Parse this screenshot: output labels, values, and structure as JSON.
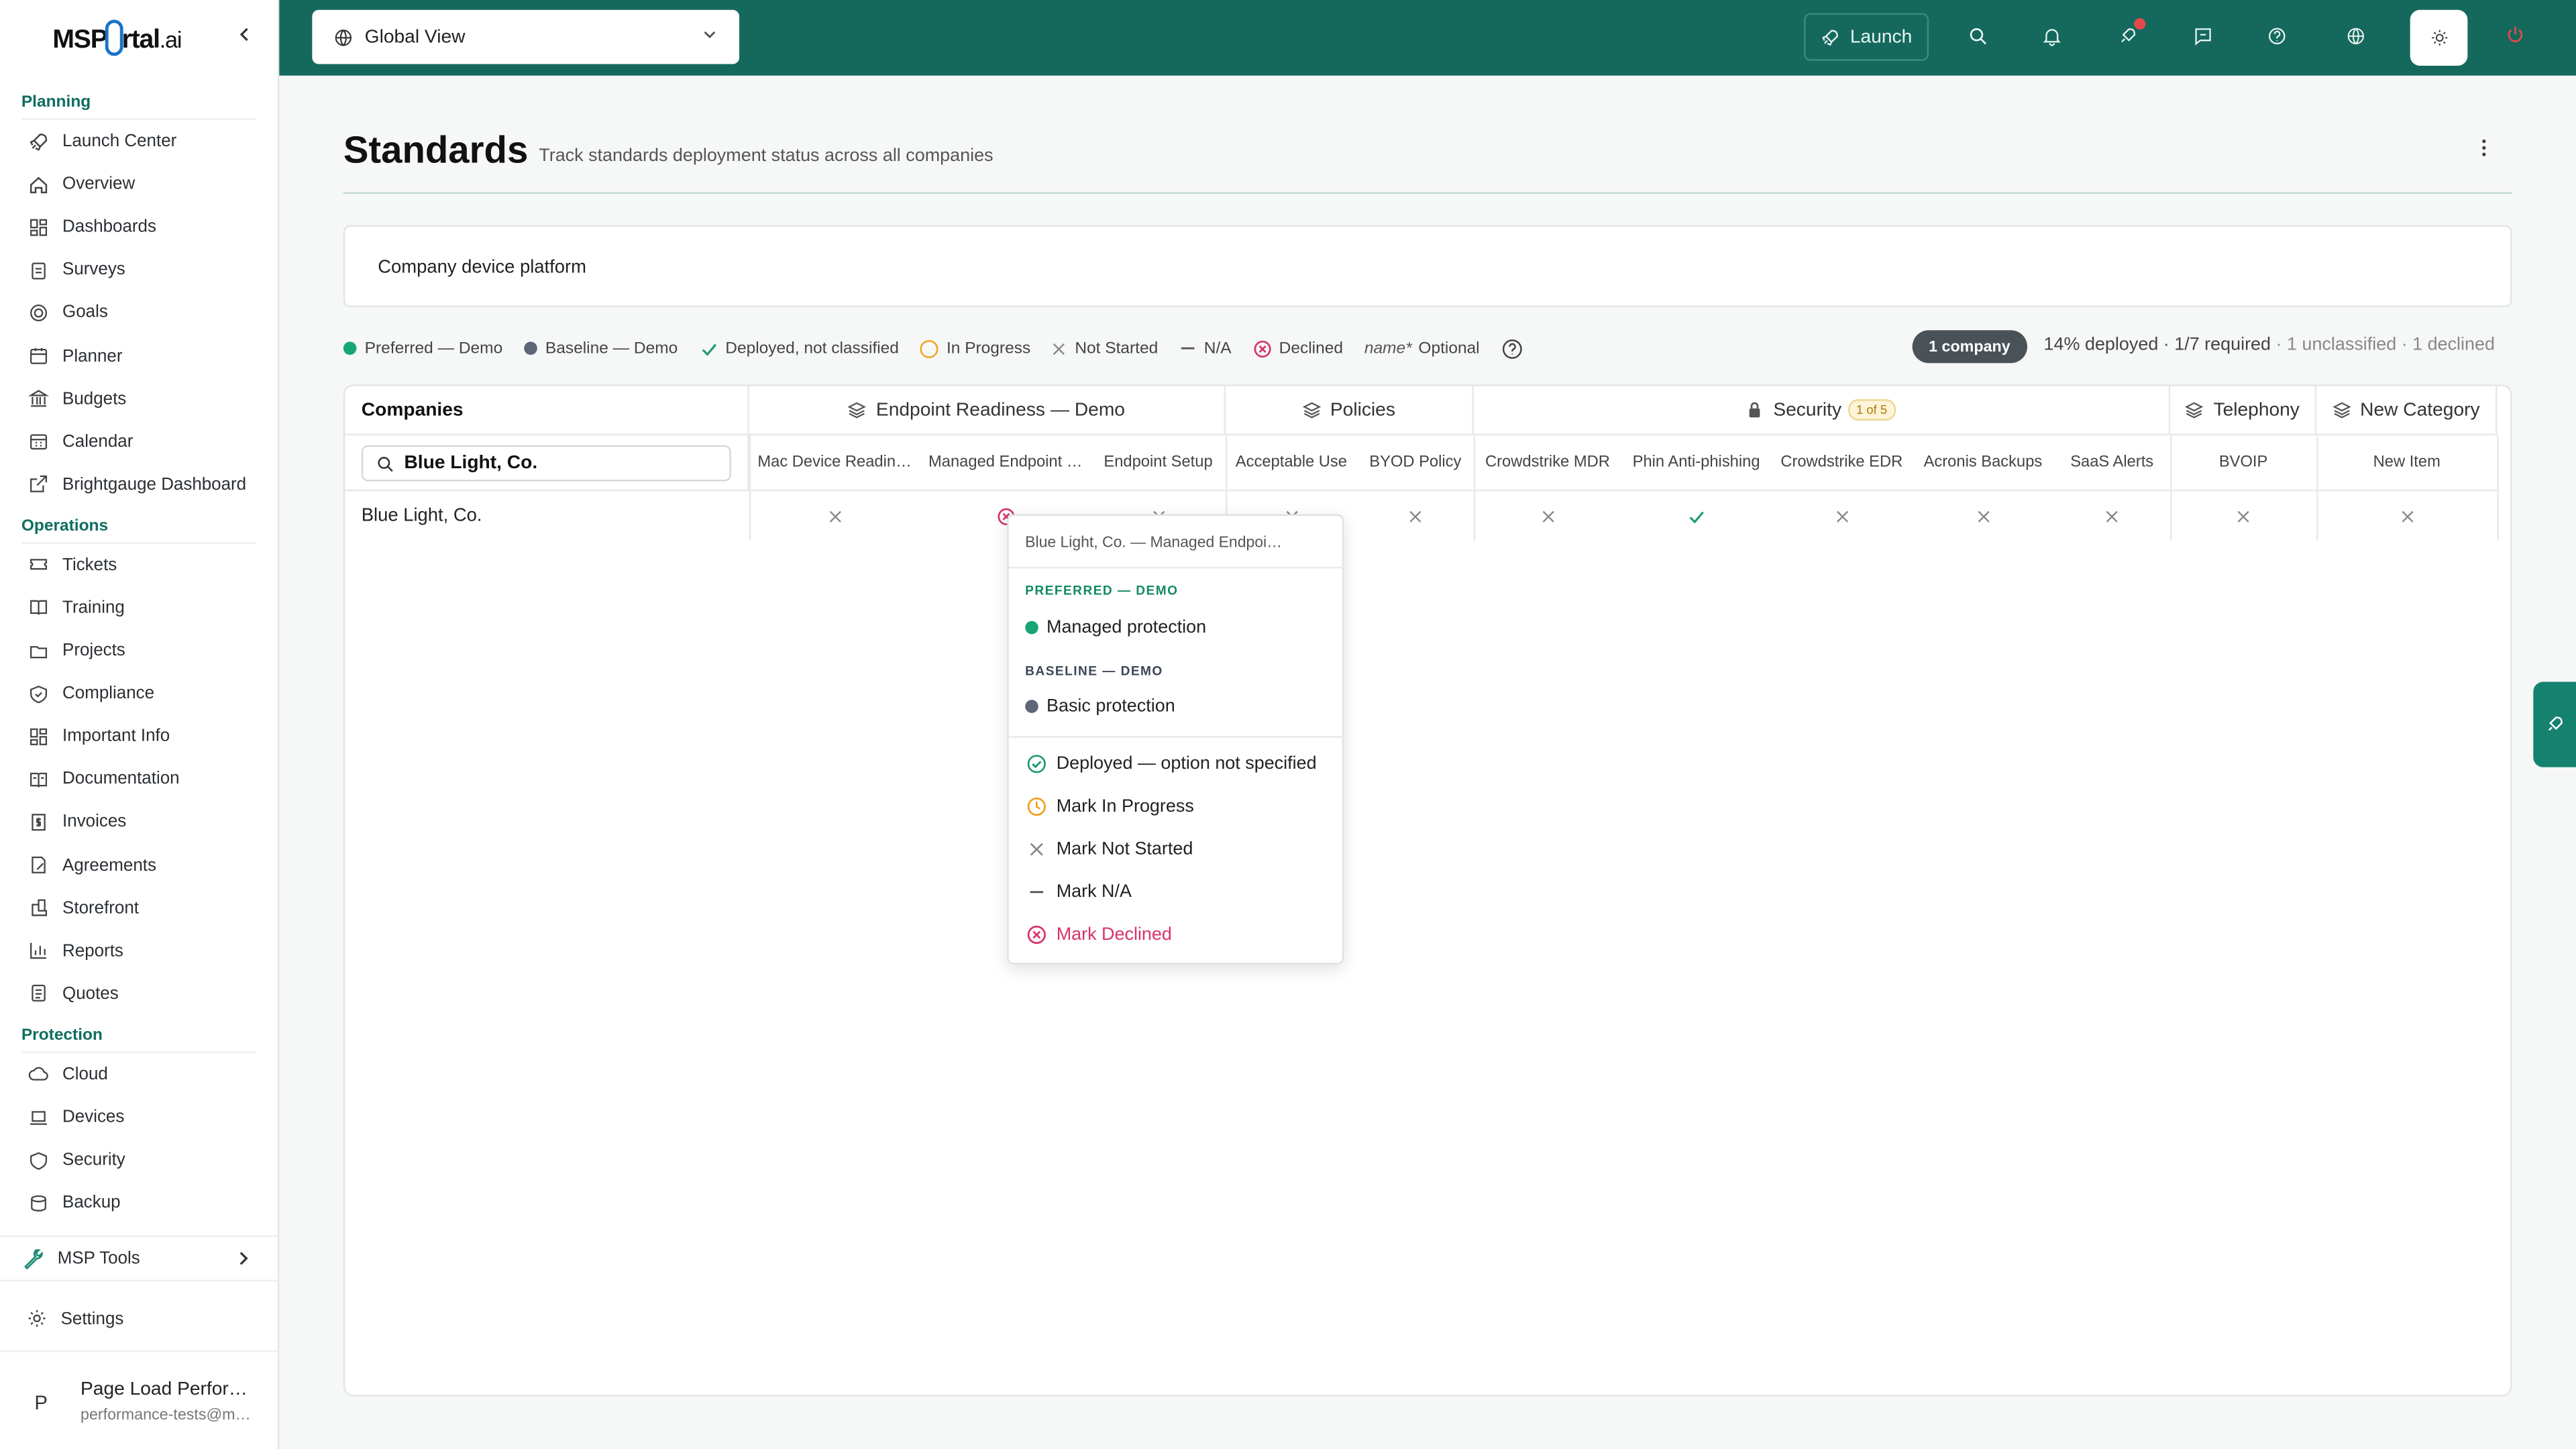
{
  "brand": {
    "logo_left": "MSP",
    "logo_right": "rtal",
    "logo_ai": ".ai"
  },
  "sidebar": {
    "sections": [
      {
        "title": "Planning",
        "items": [
          {
            "label": "Launch Center",
            "icon": "rocket-icon"
          },
          {
            "label": "Overview",
            "icon": "home-icon"
          },
          {
            "label": "Dashboards",
            "icon": "grid-icon"
          },
          {
            "label": "Surveys",
            "icon": "clipboard-icon"
          },
          {
            "label": "Goals",
            "icon": "target-icon"
          },
          {
            "label": "Planner",
            "icon": "calendar-icon"
          },
          {
            "label": "Budgets",
            "icon": "bank-icon"
          },
          {
            "label": "Calendar",
            "icon": "calendar-grid-icon"
          },
          {
            "label": "Brightgauge Dashboard",
            "icon": "external-link-icon"
          }
        ]
      },
      {
        "title": "Operations",
        "items": [
          {
            "label": "Tickets",
            "icon": "ticket-icon"
          },
          {
            "label": "Training",
            "icon": "book-icon"
          },
          {
            "label": "Projects",
            "icon": "folder-icon"
          },
          {
            "label": "Compliance",
            "icon": "shield-check-icon"
          },
          {
            "label": "Important Info",
            "icon": "grid-icon"
          },
          {
            "label": "Documentation",
            "icon": "book-open-icon"
          },
          {
            "label": "Invoices",
            "icon": "invoice-icon"
          },
          {
            "label": "Agreements",
            "icon": "file-sign-icon"
          },
          {
            "label": "Storefront",
            "icon": "store-icon"
          },
          {
            "label": "Reports",
            "icon": "bar-chart-icon"
          },
          {
            "label": "Quotes",
            "icon": "file-icon"
          }
        ]
      },
      {
        "title": "Protection",
        "items": [
          {
            "label": "Cloud",
            "icon": "cloud-icon"
          },
          {
            "label": "Devices",
            "icon": "laptop-icon"
          },
          {
            "label": "Security",
            "icon": "shield-icon"
          },
          {
            "label": "Backup",
            "icon": "database-icon"
          }
        ]
      }
    ],
    "tools_label": "MSP Tools",
    "settings_label": "Settings",
    "user": {
      "initial": "P",
      "name": "Page Load Perfor…",
      "email": "performance-tests@m…"
    }
  },
  "topbar": {
    "scope": "Global View",
    "launch_label": "Launch"
  },
  "page": {
    "title": "Standards",
    "subtitle": "Track standards deployment status across all companies",
    "platform_label": "Company device platform"
  },
  "legend": {
    "preferred": "Preferred — Demo",
    "baseline": "Baseline — Demo",
    "deployed": "Deployed, not classified",
    "in_progress": "In Progress",
    "not_started": "Not Started",
    "na": "N/A",
    "declined": "Declined",
    "optional_prefix": "name*",
    "optional": "Optional"
  },
  "summary": {
    "companies_badge": "1 company",
    "deployed": "14% deployed · 1/7 required",
    "extra": " · 1 unclassified · 1 declined"
  },
  "table": {
    "companies_header": "Companies",
    "search_value": "Blue Light, Co.",
    "groups": [
      {
        "label": "Endpoint Readiness — Demo",
        "icon": "layers-icon"
      },
      {
        "label": "Policies",
        "icon": "layers-icon"
      },
      {
        "label": "Security",
        "icon": "lock-icon",
        "badge": "1 of 5"
      },
      {
        "label": "Telephony",
        "icon": "layers-icon"
      },
      {
        "label": "New Category",
        "icon": "layers-icon"
      }
    ],
    "columns": [
      "Mac Device Readin…",
      "Managed Endpoint …",
      "Endpoint Setup",
      "Acceptable Use",
      "BYOD Policy",
      "Crowdstrike MDR",
      "Phin Anti-phishing",
      "Crowdstrike EDR",
      "Acronis Backups",
      "SaaS Alerts",
      "BVOIP",
      "New Item"
    ],
    "rows": [
      {
        "company": "Blue Light, Co.",
        "statuses": [
          "not-started",
          "declined",
          "not-started",
          "not-started",
          "not-started",
          "not-started",
          "deployed",
          "not-started",
          "not-started",
          "not-started",
          "not-started",
          "not-started"
        ]
      }
    ]
  },
  "popover": {
    "header": "Blue Light, Co. — Managed Endpoi…",
    "preferred_title": "PREFERRED — DEMO",
    "preferred_option": "Managed protection",
    "baseline_title": "BASELINE — DEMO",
    "baseline_option": "Basic protection",
    "actions": {
      "deployed": "Deployed — option not specified",
      "in_progress": "Mark In Progress",
      "not_started": "Mark Not Started",
      "na": "Mark N/A",
      "declined": "Mark Declined"
    }
  },
  "colors": {
    "brand_teal": "#14695c",
    "preferred": "#17a673",
    "baseline": "#5c6676",
    "deployed": "#1f9b6e",
    "in_progress": "#f1a21b",
    "declined": "#d6336c"
  }
}
